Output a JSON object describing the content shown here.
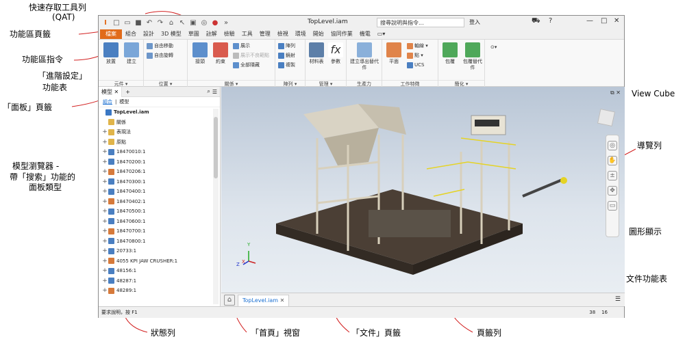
{
  "callouts": {
    "qat": "快速存取工具列",
    "qat_sub": "(QAT)",
    "ribbon_tab": "功能區頁籤",
    "ribbon_cmd": "功能區指令",
    "adv_settings": "「進階設定」",
    "adv_settings_sub": "功能表",
    "panel_tab": "「面板」頁籤",
    "browser_1": "模型瀏覽器 -",
    "browser_2": "帶「搜索」功能的",
    "browser_3": "面板類型",
    "viewcube": "View Cube",
    "navbar": "導覽列",
    "graphics": "圖形顯示",
    "doc_menu": "文件功能表",
    "statusbar": "狀態列",
    "home_view": "「首頁」視窗",
    "doc_tab": "「文件」頁籤",
    "tab_bar": "頁籤列"
  },
  "window": {
    "title": "TopLevel.iam",
    "search_placeholder": "搜尋說明與指令...",
    "login": "登入",
    "help": "?"
  },
  "ribbon_tabs": [
    "檔案",
    "組合",
    "設計",
    "3D 模型",
    "草圖",
    "註解",
    "檢驗",
    "工具",
    "管理",
    "檢視",
    "環境",
    "開始",
    "協同作業",
    "機電"
  ],
  "ribbon": {
    "component": {
      "label": "元件 ▾",
      "place": "放置",
      "create": "建立"
    },
    "position": {
      "label": "位置 ▾",
      "free_move": "自由移動",
      "free_rotate": "自由旋轉"
    },
    "relationships": {
      "label": "關係 ▾",
      "joint": "接頭",
      "constrain": "約束",
      "show": "展示",
      "show_sick": "展示不良範點",
      "hide_all": "全部隱藏"
    },
    "pattern": {
      "label": "陣列 ▾",
      "array": "陣列",
      "mirror": "鏡射",
      "copy": "複製"
    },
    "manage": {
      "label": "管理 ▾",
      "bom": "材料表",
      "params": "參數"
    },
    "productivity": {
      "label": "生產力",
      "substitute": "建立導出替代件"
    },
    "work_features": {
      "label": "工作特徵",
      "plane": "平面",
      "axis": "軸線 ▾",
      "point": "點 ▾",
      "ucs": "UCS"
    },
    "simplify": {
      "label": "簡化 ▾",
      "shrinkwrap": "包覆",
      "shrinkwrap_sub": "包覆替代件"
    }
  },
  "browser": {
    "tab_label": "模型",
    "sub_assembly": "組合",
    "sub_model": "模型",
    "nodes": [
      "TopLevel.iam",
      "關係",
      "表現法",
      "原點",
      "18470010:1",
      "18470200:1",
      "18470206:1",
      "18470300:1",
      "18470400:1",
      "18470402:1",
      "18470500:1",
      "18470600:1",
      "18470700:1",
      "18470800:1",
      "20733:1",
      "4055 KPI JAW CRUSHER:1",
      "48156:1",
      "48287:1",
      "48289:1"
    ]
  },
  "doc_tab": "TopLevel.iam",
  "status": {
    "help": "要求說明，按 F1",
    "count_a": "38",
    "count_b": "16"
  }
}
